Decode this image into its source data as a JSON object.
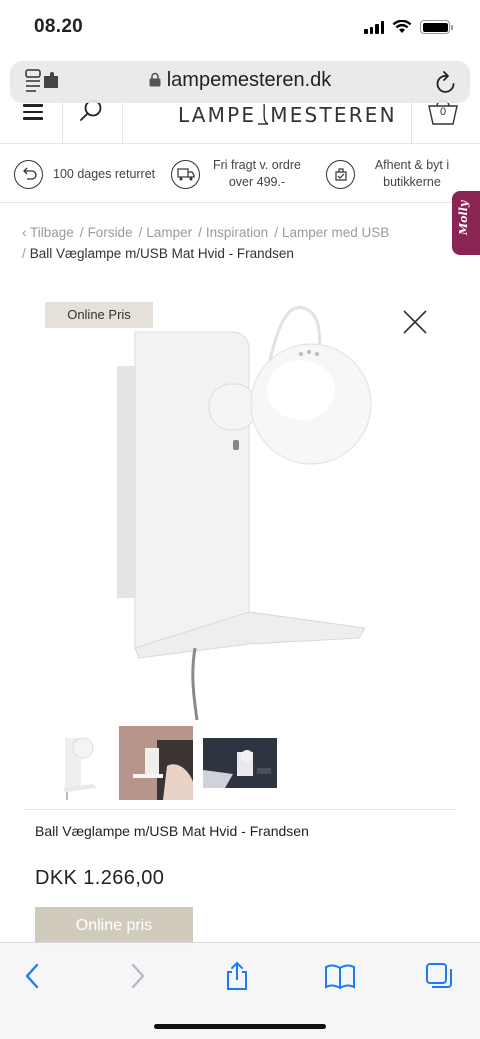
{
  "status": {
    "time": "08.20"
  },
  "browser": {
    "url": "lampemesteren.dk"
  },
  "header": {
    "logo_left": "LAMPE",
    "logo_right": "MESTEREN",
    "cart_count": "0"
  },
  "usp": [
    {
      "icon": "return-icon",
      "text": "100 dages returret"
    },
    {
      "icon": "truck-icon",
      "text": "Fri fragt v. ordre over 499.-"
    },
    {
      "icon": "store-icon",
      "text": "Afhent & byt i butikkerne"
    }
  ],
  "molly": {
    "label": "Molly"
  },
  "breadcrumb": {
    "items": [
      "Tilbage",
      "Forside",
      "Lamper",
      "Inspiration",
      "Lamper med USB"
    ],
    "current": "Ball Væglampe m/USB Mat Hvid - Frandsen"
  },
  "product": {
    "badge": "Online Pris",
    "title": "Ball Væglampe m/USB Mat Hvid - Frandsen",
    "price": "DKK 1.266,00",
    "cta": "Online pris"
  },
  "colors": {
    "accent": "#8a2452",
    "badge_bg": "#e6e1d8",
    "cta_bg": "#d0cbbd",
    "link_blue": "#1e7cf2"
  }
}
